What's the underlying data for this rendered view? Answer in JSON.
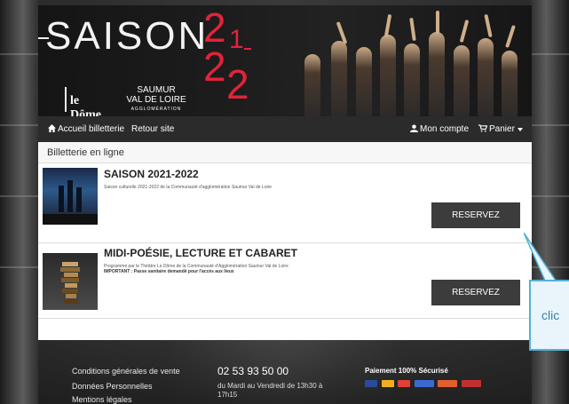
{
  "banner": {
    "saison": "SAISON",
    "year_digits": [
      "2",
      "1",
      "2",
      "2"
    ],
    "dome_logo": "le Dôme",
    "saumur_logo_line1": "SAUMUR",
    "saumur_logo_line2": "VAL DE LOIRE",
    "saumur_logo_sub": "AGGLOMÉRATION"
  },
  "nav": {
    "home": "Accueil billetterie",
    "back": "Retour site",
    "account": "Mon compte",
    "cart": "Panier"
  },
  "content": {
    "section_title": "Billetterie en ligne",
    "events": [
      {
        "title": "SAISON 2021-2022",
        "description": "Saison culturelle 2021-2022 de la Communauté d'agglomération Saumur Val de Loire",
        "note": "",
        "button": "RESERVEZ"
      },
      {
        "title": "MIDI-POÉSIE, LECTURE ET CABARET",
        "description": "Programmé par le Théâtre Le Dôme de la Communauté d'Agglomération Saumur Val de Loire",
        "note": "IMPORTANT : Passe sanitaire demandé pour l'accès aux lieux",
        "button": "RESERVEZ"
      }
    ]
  },
  "footer": {
    "links": [
      "Conditions générales de vente",
      "Données Personnelles",
      "Mentions légales"
    ],
    "phone": "02 53 93 50 00",
    "hours": "du Mardi au Vendredi de 13h30 à 17h15",
    "secure": "Paiement 100% Sécurisé"
  },
  "callout": {
    "text": "clic"
  },
  "colors": {
    "accent_red": "#e2233a",
    "nav_bg": "#2b2b2b",
    "button_bg": "#3c3c3c",
    "callout_border": "#52b2d8"
  }
}
